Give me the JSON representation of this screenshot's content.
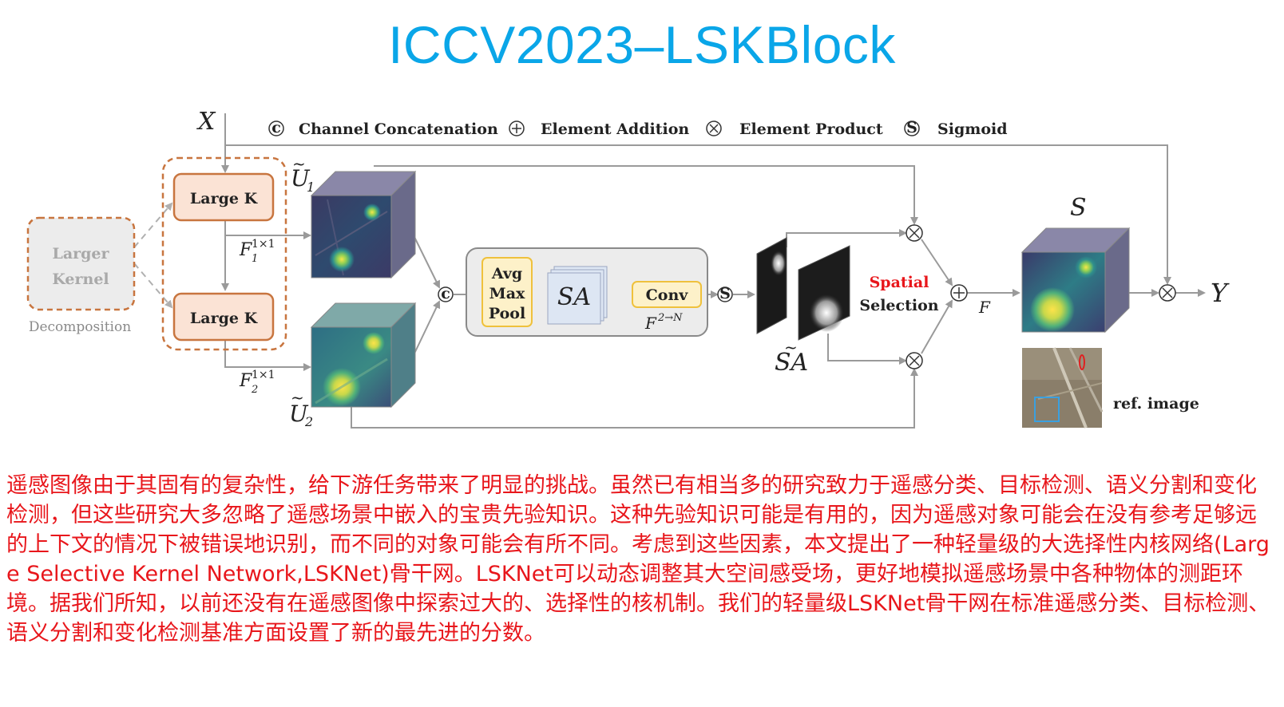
{
  "title": "ICCV2023–LSKBlock",
  "legend": {
    "c_symbol": "c",
    "concat": "Channel Concatenation",
    "addition": "Element Addition",
    "product": "Element Product",
    "s_symbol": "S",
    "sigmoid": "Sigmoid"
  },
  "input": "X",
  "output": "Y",
  "decomposition": {
    "larger_kernel_line1": "Larger",
    "larger_kernel_line2": "Kernel",
    "caption": "Decomposition",
    "large_k_1": "Large K",
    "large_k_2": "Large K"
  },
  "features": {
    "u1": "U",
    "u1_sub": "1",
    "u2": "U",
    "u2_sub": "2",
    "f1": "F",
    "f1_sub": "1",
    "f1_sup": "1×1",
    "f2": "F",
    "f2_sub": "2",
    "f2_sup": "1×1"
  },
  "sa_block": {
    "pool_line1": "Avg",
    "pool_line2": "Max",
    "pool_line3": "Pool",
    "sa": "SA",
    "conv": "Conv",
    "conv_caption": "F",
    "conv_caption_sup": "2→N"
  },
  "selection": {
    "sa_tilde": "SA",
    "spatial": "Spatial",
    "selection": "Selection",
    "f_label": "F",
    "s_label": "S",
    "ref_image": "ref. image"
  },
  "colors": {
    "title": "#0aa6e8",
    "text_red": "#e8161b",
    "large_k_fill": "#fbe3d5",
    "large_k_border": "#c8753f",
    "pool_conv_fill": "#fdf1c9",
    "pool_conv_border": "#efc13c",
    "sa_fill": "#dde6f3",
    "spatial_red": "#e8161b",
    "arrow": "#9a9a9a"
  },
  "description": "遥感图像由于其固有的复杂性，给下游任务带来了明显的挑战。虽然已有相当多的研究致力于遥感分类、目标检测、语义分割和变化检测，但这些研究大多忽略了遥感场景中嵌入的宝贵先验知识。这种先验知识可能是有用的，因为遥感对象可能会在没有参考足够远的上下文的情况下被错误地识别，而不同的对象可能会有所不同。考虑到这些因素，本文提出了一种轻量级的大选择性内核网络(Large Selective Kernel Network,LSKNet)骨干网。LSKNet可以动态调整其大空间感受场，更好地模拟遥感场景中各种物体的测距环境。据我们所知，以前还没有在遥感图像中探索过大的、选择性的核机制。我们的轻量级LSKNet骨干网在标准遥感分类、目标检测、语义分割和变化检测基准方面设置了新的最先进的分数。"
}
